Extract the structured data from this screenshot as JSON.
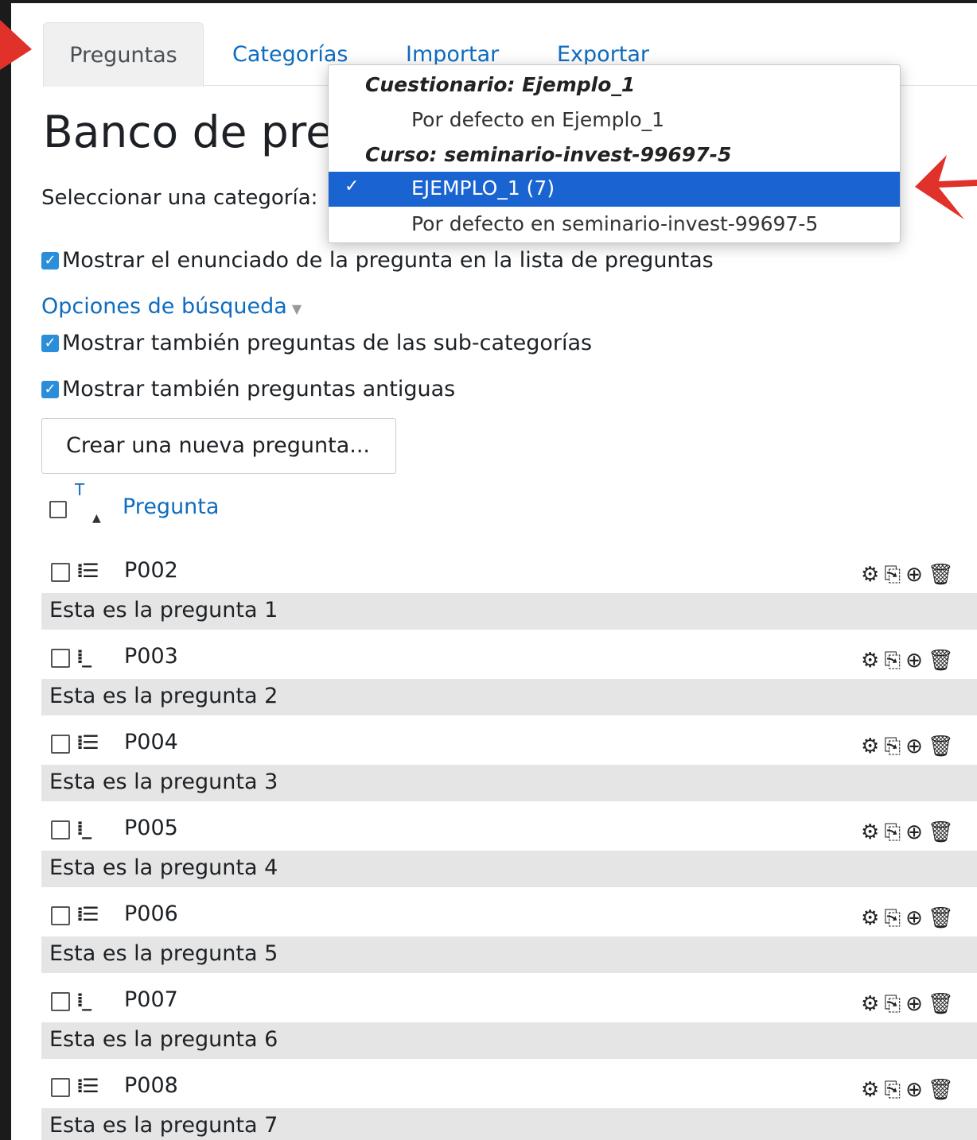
{
  "tabs": [
    {
      "label": "Preguntas",
      "active": true
    },
    {
      "label": "Categorías",
      "active": false
    },
    {
      "label": "Importar",
      "active": false
    },
    {
      "label": "Exportar",
      "active": false
    }
  ],
  "page_title": "Banco de pre",
  "select_category_label": "Seleccionar una categoría:",
  "category_dropdown": {
    "group_1": "Cuestionario: Ejemplo_1",
    "group_1_item": "Por defecto en Ejemplo_1",
    "group_2": "Curso: seminario-invest-99697-5",
    "selected_item": "EJEMPLO_1 (7)",
    "group_2_item": "Por defecto en seminario-invest-99697-5"
  },
  "options": {
    "show_question_text": "Mostrar el enunciado de la pregunta en la lista de preguntas",
    "search_options_label": "Opciones de búsqueda",
    "show_subcategories": "Mostrar también preguntas de las sub-categorías",
    "show_old_questions": "Mostrar también preguntas antiguas"
  },
  "create_button": "Crear una nueva pregunta...",
  "table": {
    "sort_t": "T",
    "column_title": "Pregunta",
    "rows": [
      {
        "name": "P002",
        "text": "Esta es la pregunta 1"
      },
      {
        "name": "P003",
        "text": "Esta es la pregunta 2"
      },
      {
        "name": "P004",
        "text": "Esta es la pregunta 3"
      },
      {
        "name": "P005",
        "text": "Esta es la pregunta 4"
      },
      {
        "name": "P006",
        "text": "Esta es la pregunta 5"
      },
      {
        "name": "P007",
        "text": "Esta es la pregunta 6"
      },
      {
        "name": "P008",
        "text": "Esta es la pregunta 7"
      }
    ]
  },
  "colors": {
    "accent": "#0f6cbf",
    "selected": "#1a64d2",
    "annotation": "#e0322b"
  }
}
